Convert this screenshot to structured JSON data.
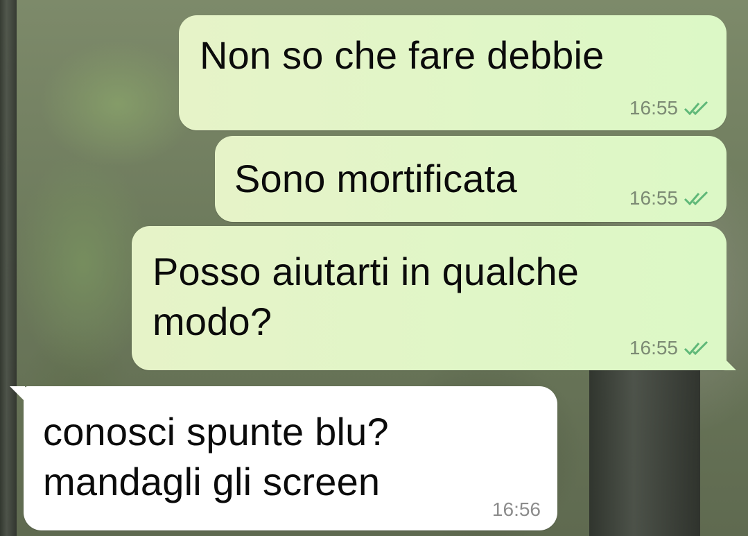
{
  "chat": {
    "messages": [
      {
        "direction": "out",
        "text": "Non so che fare debbie",
        "time": "16:55",
        "status": "read-ticks"
      },
      {
        "direction": "out",
        "text": "Sono mortificata",
        "time": "16:55",
        "status": "read-ticks"
      },
      {
        "direction": "out",
        "text": "Posso aiutarti in qualche\nmodo?",
        "time": "16:55",
        "status": "read-ticks"
      },
      {
        "direction": "in",
        "text": "conosci spunte blu?\nmandagli gli screen",
        "time": "16:56"
      }
    ]
  },
  "colors": {
    "outgoing_bubble": "#dcf8c6",
    "incoming_bubble": "#ffffff",
    "tick": "#5fb878"
  }
}
